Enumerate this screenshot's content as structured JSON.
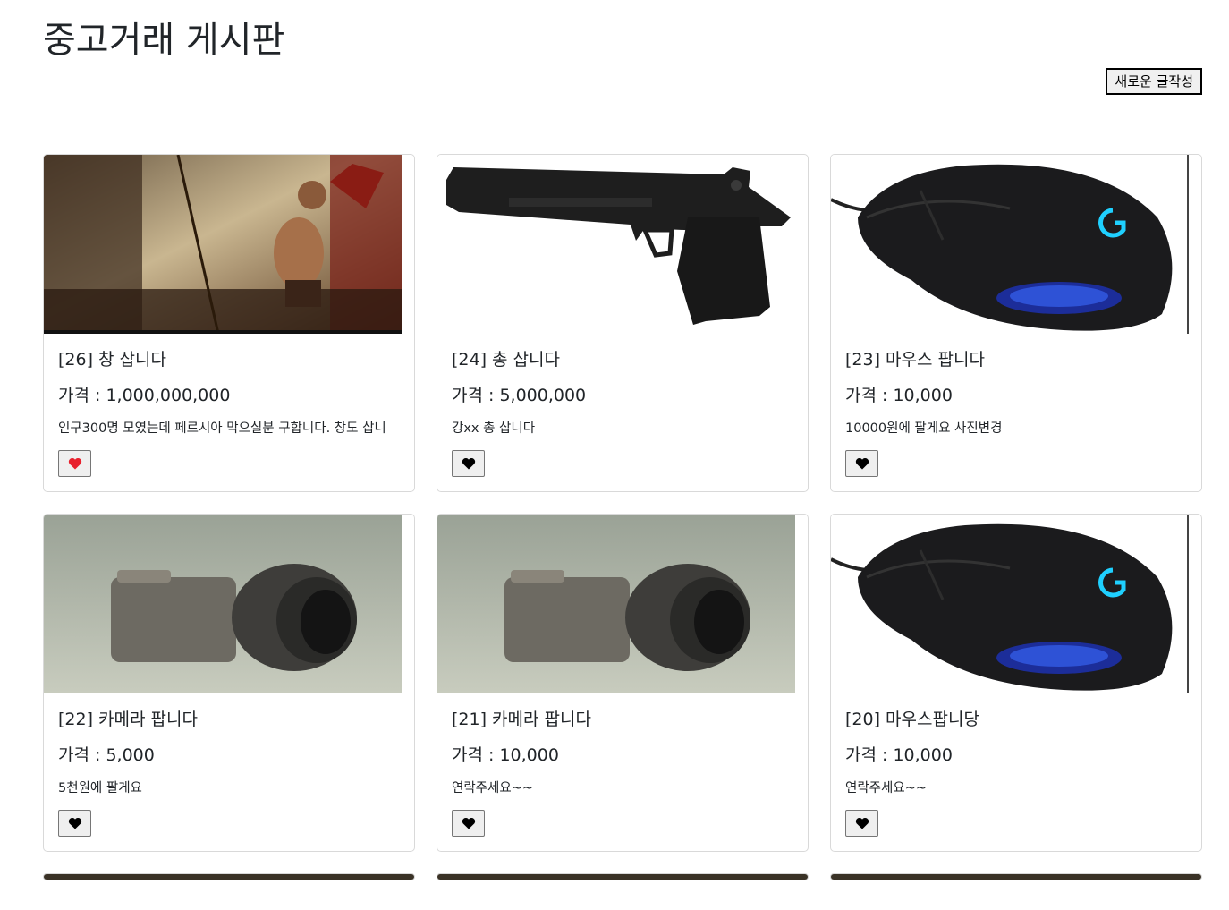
{
  "page": {
    "title": "중고거래 게시판",
    "new_post_label": "새로운 글작성"
  },
  "posts": [
    {
      "title": "[26] 창 삽니다",
      "price": "가격 : 1,000,000,000",
      "description": "인구300명 모였는데 페르시아 막으실분 구합니다. 창도 삽니",
      "liked": true,
      "image": "spartan-warrior-photo"
    },
    {
      "title": "[24] 총 삽니다",
      "price": "가격 : 5,000,000",
      "description": "강xx 총 삽니다",
      "liked": false,
      "image": "pistol-photo"
    },
    {
      "title": "[23] 마우스 팝니다",
      "price": "가격 : 10,000",
      "description": "10000원에 팔게요 사진변경",
      "liked": false,
      "image": "gaming-mouse-photo"
    },
    {
      "title": "[22] 카메라 팝니다",
      "price": "가격 : 5,000",
      "description": "5천원에 팔게요",
      "liked": false,
      "image": "camera-photo"
    },
    {
      "title": "[21] 카메라 팝니다",
      "price": "가격 : 10,000",
      "description": "연락주세요~~",
      "liked": false,
      "image": "camera-photo"
    },
    {
      "title": "[20] 마우스팝니당",
      "price": "가격 : 10,000",
      "description": "연락주세요~~",
      "liked": false,
      "image": "gaming-mouse-photo"
    }
  ],
  "colors": {
    "heart_liked": "#e8202d",
    "heart_default": "#000000",
    "card_border": "#d9d9d9"
  }
}
